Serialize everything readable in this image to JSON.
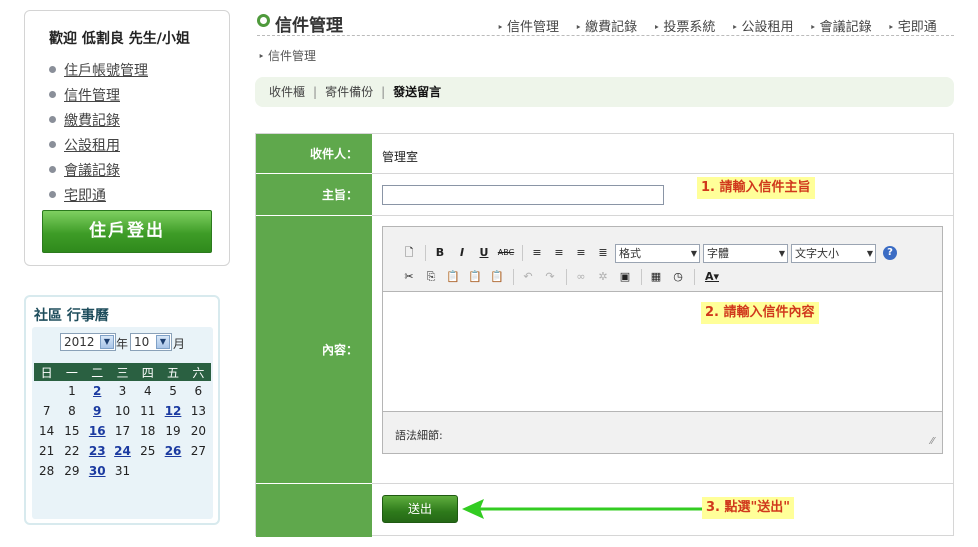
{
  "sidebar": {
    "welcome": "歡迎 低割良 先生/小姐",
    "nav": [
      {
        "label": "住戶帳號管理"
      },
      {
        "label": "信件管理"
      },
      {
        "label": "繳費記錄"
      },
      {
        "label": "公設租用"
      },
      {
        "label": "會議記錄"
      },
      {
        "label": "宅即通"
      }
    ],
    "logout_label": "住戶登出"
  },
  "calendar": {
    "title": "社區 行事曆",
    "year": "2012",
    "year_unit": "年",
    "month": "10",
    "month_unit": "月",
    "weekdays": [
      "日",
      "一",
      "二",
      "三",
      "四",
      "五",
      "六"
    ],
    "weeks": [
      [
        "",
        "1",
        "2",
        "3",
        "4",
        "5",
        "6"
      ],
      [
        "7",
        "8",
        "9",
        "10",
        "11",
        "12",
        "13"
      ],
      [
        "14",
        "15",
        "16",
        "17",
        "18",
        "19",
        "20"
      ],
      [
        "21",
        "22",
        "23",
        "24",
        "25",
        "26",
        "27"
      ],
      [
        "28",
        "29",
        "30",
        "31",
        "",
        "",
        ""
      ]
    ],
    "event_days": [
      "2",
      "9",
      "12",
      "16",
      "23",
      "24",
      "26",
      "30"
    ]
  },
  "header": {
    "title": "信件管理",
    "top_nav": [
      "信件管理",
      "繳費記錄",
      "投票系統",
      "公設租用",
      "會議記錄",
      "宅即通"
    ],
    "breadcrumb": "信件管理"
  },
  "tabs": [
    {
      "label": "收件櫃",
      "active": false
    },
    {
      "label": "寄件備份",
      "active": false
    },
    {
      "label": "發送留言",
      "active": true
    }
  ],
  "form": {
    "recipient_label": "收件人：",
    "recipient_value": "管理室",
    "subject_label": "主旨：",
    "subject_value": "",
    "content_label": "內容：",
    "send_label": "送出"
  },
  "editor": {
    "format_select": "格式",
    "font_select": "字體",
    "size_select": "文字大小",
    "status_label": "語法細節:"
  },
  "hints": {
    "subject": "1. 請輸入信件主旨",
    "content": "2. 請輸入信件內容",
    "send": "3. 點選\"送出\""
  },
  "colors": {
    "accent_green": "#5fa84c",
    "hint_background": "#ffff99",
    "hint_text": "#d0381c",
    "arrow": "#33cc22"
  }
}
